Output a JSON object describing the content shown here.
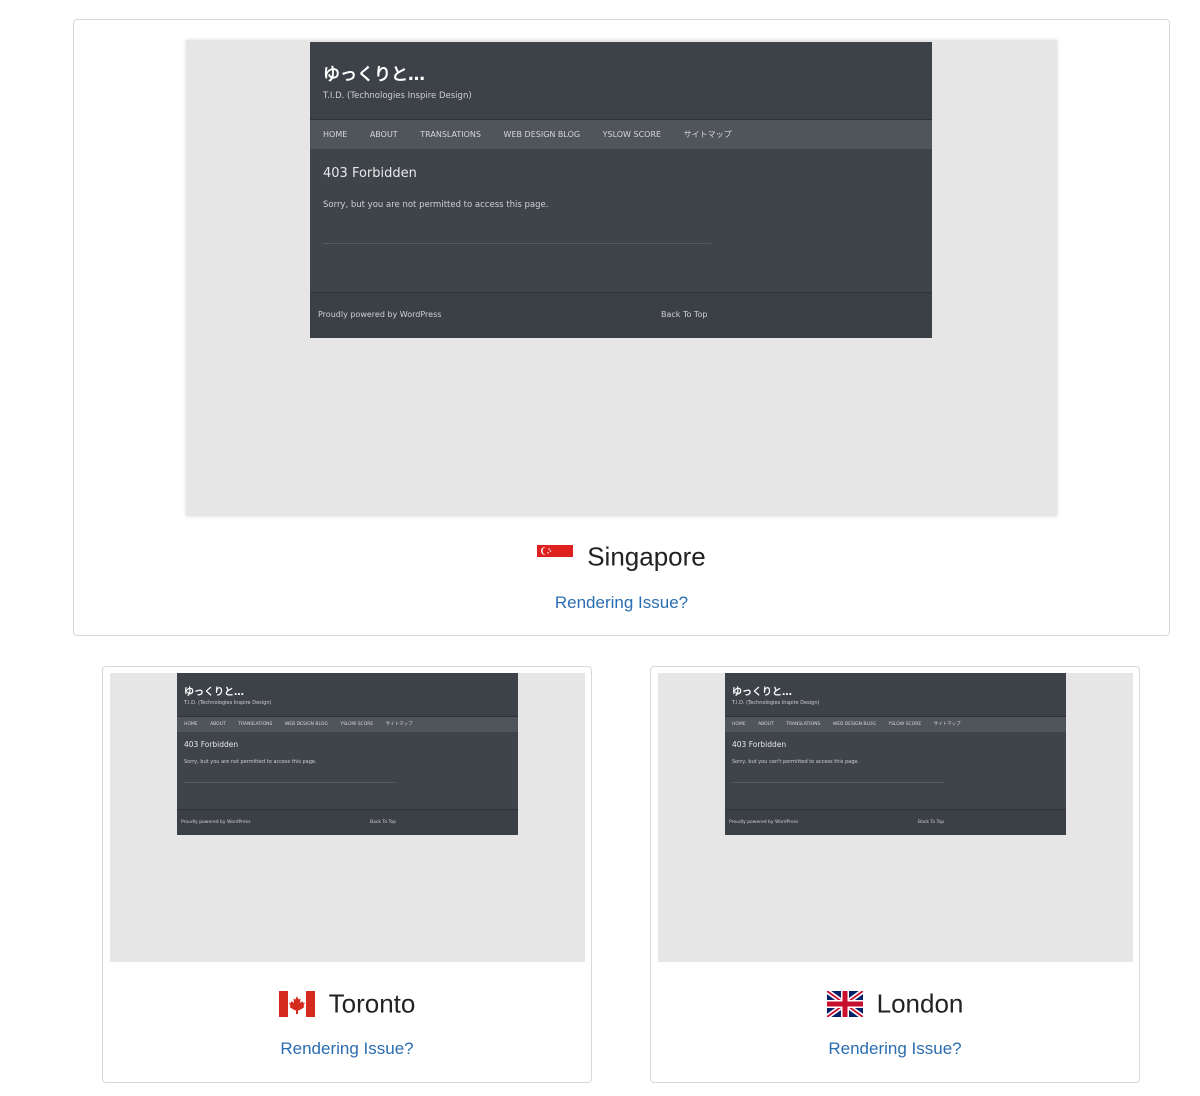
{
  "locations": [
    {
      "city": "Singapore",
      "flag_icon": "singapore-flag-icon",
      "issue_link": "Rendering Issue?",
      "site": {
        "title": "ゆっくりと…",
        "tagline": "T.I.D. (Technologies Inspire Design)",
        "nav": [
          "HOME",
          "ABOUT",
          "TRANSLATIONS",
          "WEB DESIGN BLOG",
          "YSLOW SCORE",
          "サイトマップ"
        ],
        "heading": "403 Forbidden",
        "message": "Sorry, but you are not permitted to access this page.",
        "footer_left": "Proudly powered by WordPress",
        "footer_right": "Back To Top"
      }
    },
    {
      "city": "Toronto",
      "flag_icon": "canada-flag-icon",
      "issue_link": "Rendering Issue?",
      "site": {
        "title": "ゆっくりと…",
        "tagline": "T.I.D. (Technologies Inspire Design)",
        "nav": [
          "HOME",
          "ABOUT",
          "TRANSLATIONS",
          "WEB DESIGN BLOG",
          "YSLOW SCORE",
          "サイトマップ"
        ],
        "heading": "403 Forbidden",
        "message": "Sorry, but you are not permitted to access this page.",
        "footer_left": "Proudly powered by WordPress",
        "footer_right": "Back To Top"
      }
    },
    {
      "city": "London",
      "flag_icon": "uk-flag-icon",
      "issue_link": "Rendering Issue?",
      "site": {
        "title": "ゆっくりと…",
        "tagline": "T.I.D. (Technologies Inspire Design)",
        "nav": [
          "HOME",
          "ABOUT",
          "TRANSLATIONS",
          "WEB DESIGN BLOG",
          "YSLOW SCORE",
          "サイトマップ"
        ],
        "heading": "403 Forbidden",
        "message": "Sorry, but you can't permitted to access this page.",
        "footer_left": "Proudly powered by WordPress",
        "footer_right": "Back To Top"
      }
    }
  ],
  "colors": {
    "link": "#2a6db0",
    "site_bg": "#3d4148",
    "nav_bg": "#50545b",
    "screenshot_bg": "#e6e6e6"
  }
}
